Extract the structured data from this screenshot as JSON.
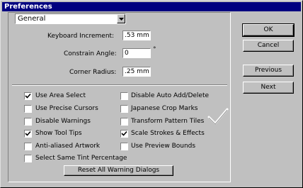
{
  "window": {
    "title": "Preferences"
  },
  "section_select": {
    "value": "General"
  },
  "fields": {
    "keyboard_increment": {
      "label": "Keyboard Increment:",
      "value": ".53 mm"
    },
    "constrain_angle": {
      "label": "Constrain Angle:",
      "value": "0",
      "unit": "°"
    },
    "corner_radius": {
      "label": "Corner Radius:",
      "value": ".25 mm"
    }
  },
  "checkboxes": [
    {
      "label": "Use Area Select",
      "checked": true
    },
    {
      "label": "Use Precise Cursors",
      "checked": false
    },
    {
      "label": "Disable Warnings",
      "checked": false
    },
    {
      "label": "Show Tool Tips",
      "checked": true
    },
    {
      "label": "Anti-aliased Artwork",
      "checked": false
    },
    {
      "label": "Select Same Tint Percentage",
      "checked": false
    },
    {
      "label": "Disable Auto Add/Delete",
      "checked": false
    },
    {
      "label": "Japanese Crop Marks",
      "checked": false
    },
    {
      "label": "Transform Pattern Tiles",
      "checked": false
    },
    {
      "label": "Scale Strokes & Effects",
      "checked": true
    },
    {
      "label": "Use Preview Bounds",
      "checked": false
    }
  ],
  "buttons": {
    "reset_warnings": "Reset All Warning Dialogs",
    "ok": "OK",
    "cancel": "Cancel",
    "previous": "Previous",
    "next": "Next"
  },
  "decor": {
    "checkmark_icon": "checkmark-icon"
  }
}
